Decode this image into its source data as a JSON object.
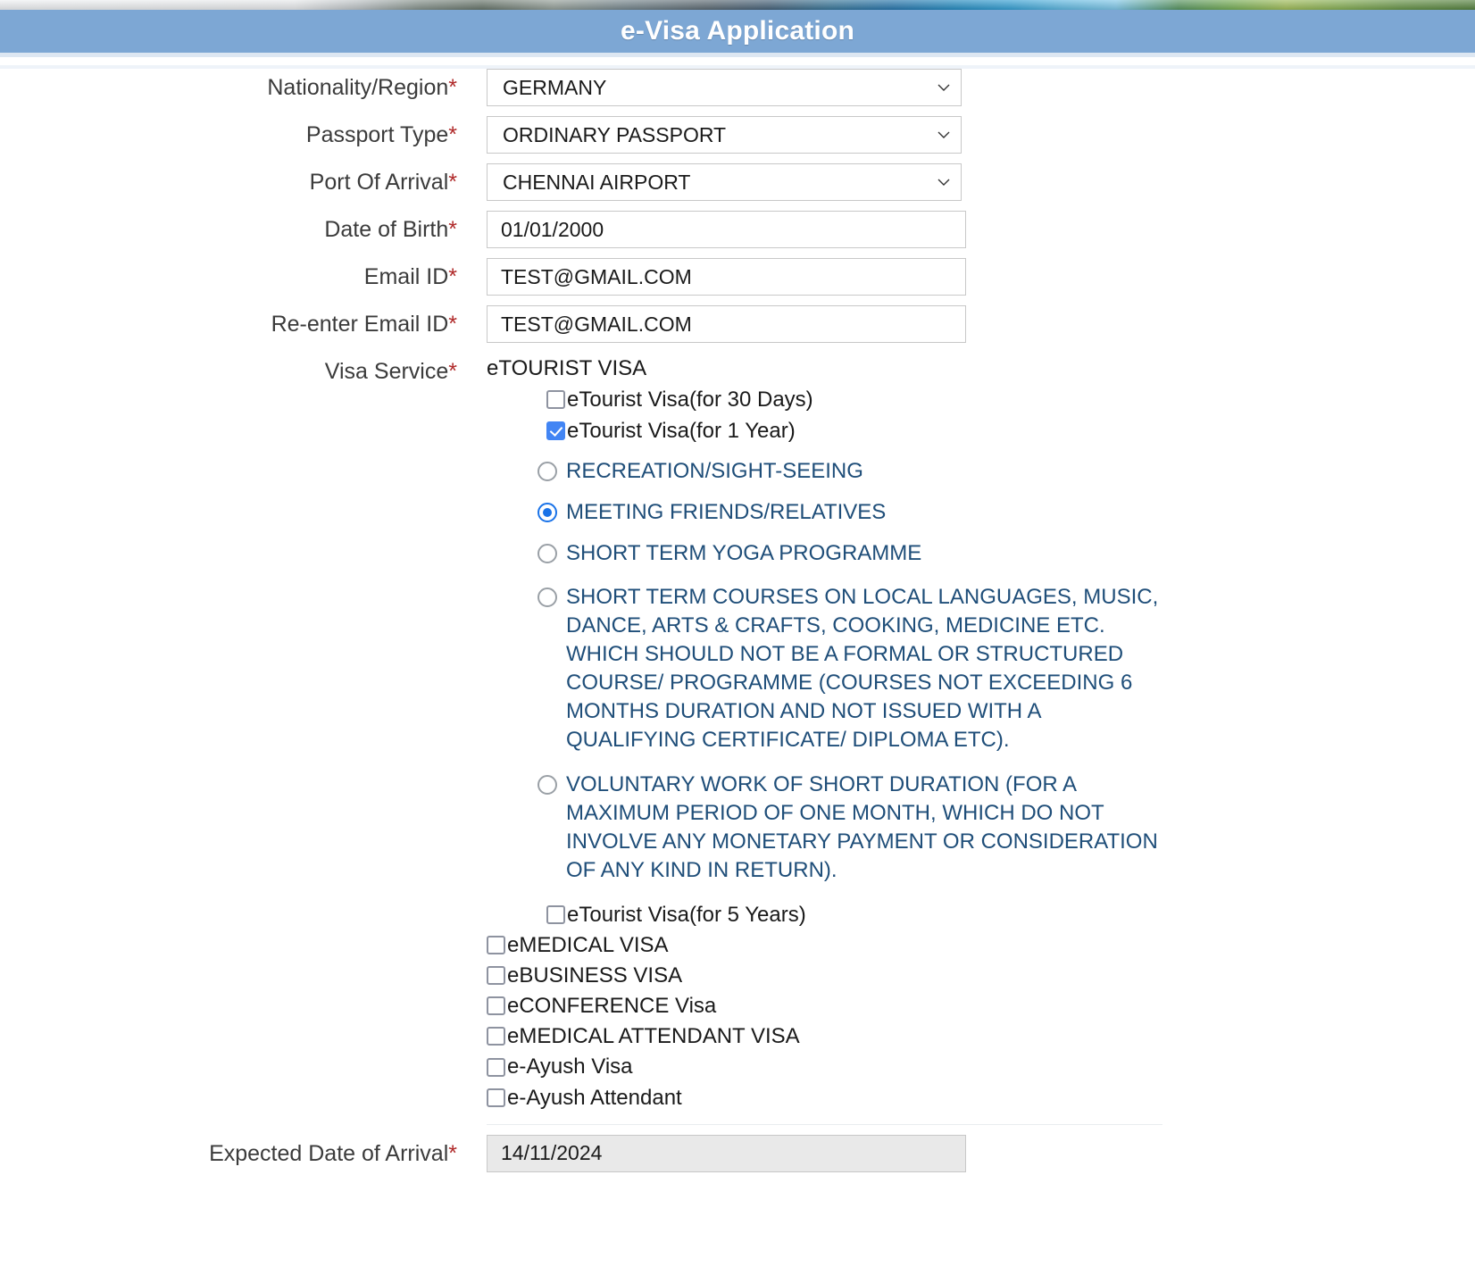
{
  "header": {
    "title": "e-Visa Application"
  },
  "form": {
    "nationality": {
      "label": "Nationality/Region",
      "required_mark": "*",
      "value": "GERMANY"
    },
    "passport_type": {
      "label": "Passport Type",
      "required_mark": "*",
      "value": "ORDINARY PASSPORT"
    },
    "port_of_arrival": {
      "label": "Port Of Arrival",
      "required_mark": "*",
      "value": "CHENNAI AIRPORT"
    },
    "date_of_birth": {
      "label": "Date of Birth",
      "required_mark": "*",
      "value": "01/01/2000"
    },
    "email": {
      "label": "Email ID",
      "required_mark": "*",
      "value": "TEST@GMAIL.COM"
    },
    "reenter_email": {
      "label": "Re-enter Email ID",
      "required_mark": "*",
      "value": "TEST@GMAIL.COM"
    },
    "visa_service": {
      "label": "Visa Service",
      "required_mark": "*",
      "group_title": "eTOURIST VISA",
      "tourist_options": [
        {
          "label": "eTourist Visa(for 30 Days)",
          "checked": false
        },
        {
          "label": "eTourist Visa(for 1 Year)",
          "checked": true
        },
        {
          "label": "eTourist Visa(for 5 Years)",
          "checked": false
        }
      ],
      "purpose_options": [
        {
          "label": "RECREATION/SIGHT-SEEING",
          "selected": false
        },
        {
          "label": "MEETING FRIENDS/RELATIVES",
          "selected": true
        },
        {
          "label": "SHORT TERM YOGA PROGRAMME",
          "selected": false
        },
        {
          "label": "SHORT TERM COURSES ON LOCAL LANGUAGES, MUSIC, DANCE, ARTS & CRAFTS, COOKING, MEDICINE ETC. WHICH SHOULD NOT BE A FORMAL OR STRUCTURED COURSE/ PROGRAMME (COURSES NOT EXCEEDING 6 MONTHS DURATION AND NOT ISSUED WITH A QUALIFYING CERTIFICATE/ DIPLOMA ETC).",
          "selected": false
        },
        {
          "label": "VOLUNTARY WORK OF SHORT DURATION (FOR A MAXIMUM PERIOD OF ONE MONTH, WHICH DO NOT INVOLVE ANY MONETARY PAYMENT OR CONSIDERATION OF ANY KIND IN RETURN).",
          "selected": false
        }
      ],
      "other_services": [
        {
          "label": "eMEDICAL VISA",
          "checked": false
        },
        {
          "label": "eBUSINESS VISA",
          "checked": false
        },
        {
          "label": "eCONFERENCE Visa",
          "checked": false
        },
        {
          "label": "eMEDICAL ATTENDANT VISA",
          "checked": false
        },
        {
          "label": "e-Ayush Visa",
          "checked": false
        },
        {
          "label": "e-Ayush Attendant",
          "checked": false
        }
      ]
    },
    "expected_arrival": {
      "label": "Expected Date of Arrival",
      "required_mark": "*",
      "value": "14/11/2024"
    }
  },
  "colors": {
    "header_blue": "#7da7d4",
    "required_red": "#b02a2a",
    "radio_label_blue": "#1f4e79",
    "checkbox_checked_blue": "#4285f4",
    "radio_selected_blue": "#1a73e8"
  }
}
